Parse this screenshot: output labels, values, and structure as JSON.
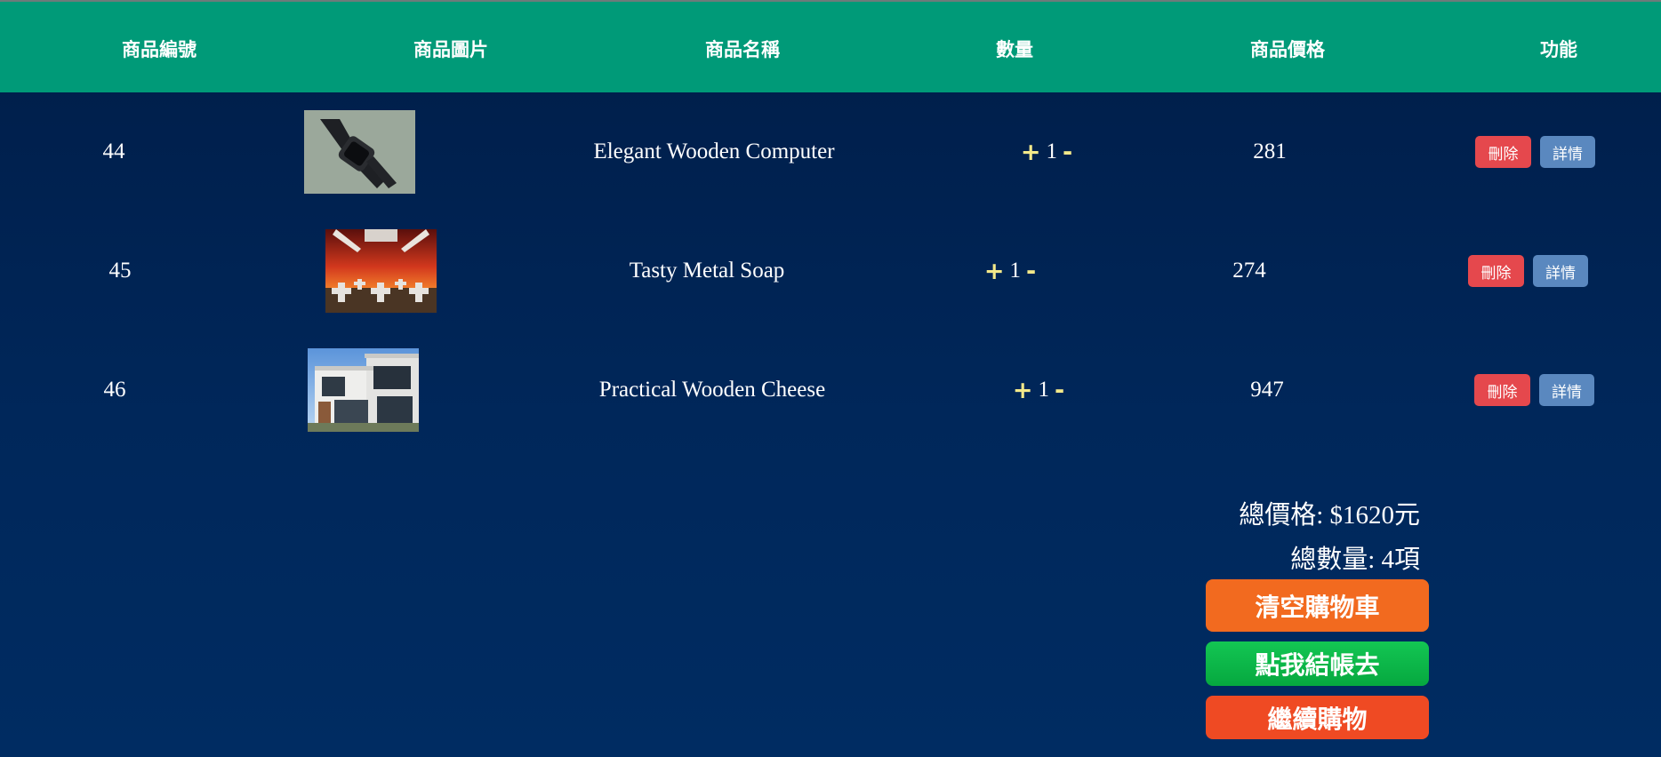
{
  "header": {
    "columns": [
      "商品編號",
      "商品圖片",
      "商品名稱",
      "數量",
      "商品價格",
      "功能"
    ]
  },
  "rows": [
    {
      "id": "44",
      "name": "Elegant Wooden Computer",
      "qty_plus": "+",
      "qty": "1",
      "qty_minus": "-",
      "price": "281",
      "delete_label": "刪除",
      "detail_label": "詳情",
      "image_icon": "watch-photo"
    },
    {
      "id": "45",
      "name": "Tasty Metal Soap",
      "qty_plus": "+",
      "qty": "1",
      "qty_minus": "-",
      "price": "274",
      "delete_label": "刪除",
      "detail_label": "詳情",
      "image_icon": "crosses-red-sky-photo"
    },
    {
      "id": "46",
      "name": "Practical Wooden Cheese",
      "qty_plus": "+",
      "qty": "1",
      "qty_minus": "-",
      "price": "947",
      "delete_label": "刪除",
      "detail_label": "詳情",
      "image_icon": "modern-house-photo"
    }
  ],
  "summary": {
    "total_price": "總價格: $1620元",
    "total_qty": "總數量: 4項",
    "clear_label": "清空購物車",
    "checkout_label": "點我結帳去",
    "continue_label": "繼續購物"
  },
  "colors": {
    "header_bg": "#009a78",
    "page_bg": "#00275a",
    "delete": "#e5484d",
    "detail": "#5a88bf",
    "qty_sign": "#f3e98a",
    "clear": "#f26a1f",
    "checkout": "#06b444",
    "continue": "#ef4a23"
  }
}
